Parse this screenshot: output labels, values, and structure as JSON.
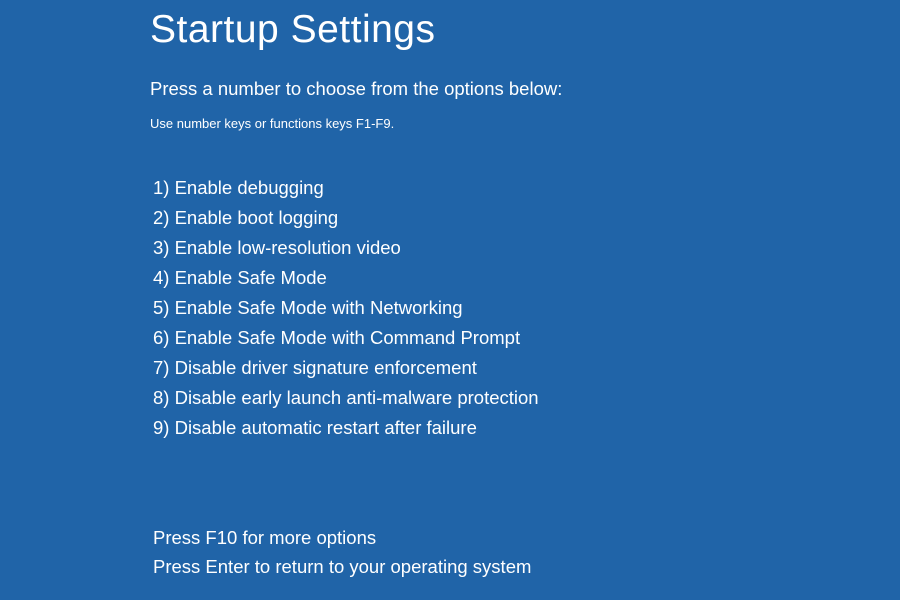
{
  "title": "Startup Settings",
  "instruction": "Press a number to choose from the options below:",
  "hint": "Use number keys or functions keys F1-F9.",
  "options": [
    "1) Enable debugging",
    "2) Enable boot logging",
    "3) Enable low-resolution video",
    "4) Enable Safe Mode",
    "5) Enable Safe Mode with Networking",
    "6) Enable Safe Mode with Command Prompt",
    "7) Disable driver signature enforcement",
    "8) Disable early launch anti-malware protection",
    "9) Disable automatic restart after failure"
  ],
  "footer": {
    "more": "Press F10 for more options",
    "return": "Press Enter to return to your operating system"
  }
}
